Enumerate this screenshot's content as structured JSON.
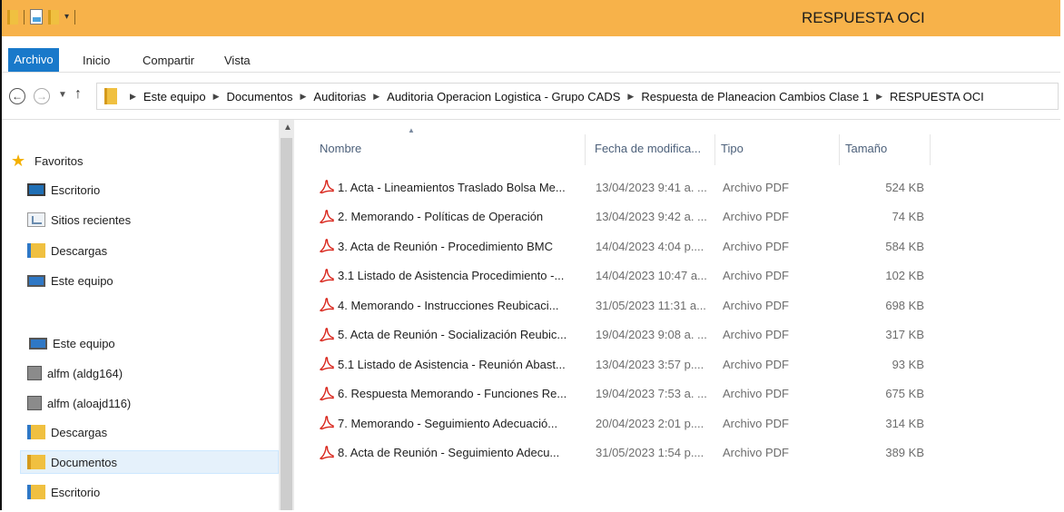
{
  "window": {
    "title": "RESPUESTA OCI"
  },
  "ribbon": {
    "tabs": [
      "Archivo",
      "Inicio",
      "Compartir",
      "Vista"
    ]
  },
  "address": {
    "crumbs": [
      "Este equipo",
      "Documentos",
      "Auditorias",
      "Auditoria Operacion Logistica - Grupo CADS",
      "Respuesta de Planeacion Cambios Clase 1",
      "RESPUESTA OCI"
    ]
  },
  "nav": {
    "favorites_label": "Favoritos",
    "favorites": [
      "Escritorio",
      "Sitios recientes",
      "Descargas",
      "Este equipo"
    ],
    "computer_label": "Este equipo",
    "computer": [
      "alfm (aldg164)",
      "alfm (aloajd116)",
      "Descargas",
      "Documentos",
      "Escritorio"
    ]
  },
  "columns": {
    "name": "Nombre",
    "date": "Fecha de modifica...",
    "type": "Tipo",
    "size": "Tamaño"
  },
  "files": [
    {
      "name": "1. Acta - Lineamientos Traslado Bolsa Me...",
      "date": "13/04/2023 9:41 a. ...",
      "type": "Archivo PDF",
      "size": "524 KB"
    },
    {
      "name": "2. Memorando - Políticas de Operación",
      "date": "13/04/2023 9:42 a. ...",
      "type": "Archivo PDF",
      "size": "74 KB"
    },
    {
      "name": "3. Acta de Reunión - Procedimiento BMC",
      "date": "14/04/2023 4:04 p....",
      "type": "Archivo PDF",
      "size": "584 KB"
    },
    {
      "name": "3.1 Listado de Asistencia Procedimiento -...",
      "date": "14/04/2023 10:47 a...",
      "type": "Archivo PDF",
      "size": "102 KB"
    },
    {
      "name": "4. Memorando - Instrucciones Reubicaci...",
      "date": "31/05/2023 11:31 a...",
      "type": "Archivo PDF",
      "size": "698 KB"
    },
    {
      "name": "5. Acta de Reunión - Socialización Reubic...",
      "date": "19/04/2023 9:08 a. ...",
      "type": "Archivo PDF",
      "size": "317 KB"
    },
    {
      "name": "5.1 Listado de Asistencia - Reunión Abast...",
      "date": "13/04/2023 3:57 p....",
      "type": "Archivo PDF",
      "size": "93 KB"
    },
    {
      "name": "6. Respuesta Memorando - Funciones Re...",
      "date": "19/04/2023 7:53 a. ...",
      "type": "Archivo PDF",
      "size": "675 KB"
    },
    {
      "name": "7. Memorando - Seguimiento Adecuació...",
      "date": "20/04/2023 2:01 p....",
      "type": "Archivo PDF",
      "size": "314 KB"
    },
    {
      "name": "8. Acta de Reunión  - Seguimiento Adecu...",
      "date": "31/05/2023 1:54 p....",
      "type": "Archivo PDF",
      "size": "389 KB"
    }
  ],
  "colors": {
    "titlebar": "#f7b24a",
    "file_tab": "#1979ca",
    "selection": "#e5f1fb",
    "pdf_icon": "#d9261c"
  }
}
